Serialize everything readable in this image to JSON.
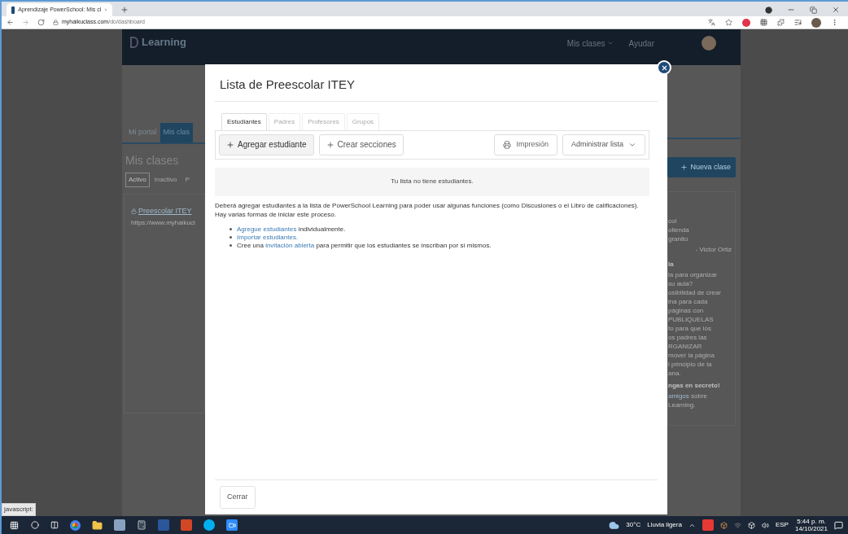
{
  "browser": {
    "tab_title": "Aprendizaje PowerSchool: Mis cl",
    "url_host": "myhaikuclass.com",
    "url_path": "/do/dashboard"
  },
  "background_page": {
    "logo": "Learning",
    "nav": [
      "Mis clases",
      "Ayudar"
    ],
    "tabs": [
      {
        "label": "Mi portal",
        "selected": false
      },
      {
        "label": "Mis clas",
        "selected": true
      }
    ],
    "heading": "Mis clases",
    "filters": [
      {
        "label": "Activo",
        "selected": true
      },
      {
        "label": "Inactivo",
        "selected": false
      },
      {
        "label": "P",
        "selected": false
      }
    ],
    "class_link": "Preescolar ITEY",
    "class_url": "https://www.myhaikucl",
    "new_class_button": "Nueva clase",
    "side_card": [
      {
        "kind": "text",
        "text": "col"
      },
      {
        "kind": "text",
        "text": "olienda"
      },
      {
        "kind": "text",
        "text": "granito"
      },
      {
        "kind": "author",
        "text": "- Victor Ortiz"
      },
      {
        "kind": "title",
        "text": "la"
      },
      {
        "kind": "text",
        "text": "la para organizar"
      },
      {
        "kind": "text",
        "text": "su aula?"
      },
      {
        "kind": "text",
        "text": "osibilidad de crear"
      },
      {
        "kind": "text",
        "text": "ina para cada"
      },
      {
        "kind": "text",
        "text": "páginas con"
      },
      {
        "kind": "text",
        "text": "PUBLIQUELAS"
      },
      {
        "kind": "text",
        "text": "to para que los"
      },
      {
        "kind": "text",
        "text": "os padres las"
      },
      {
        "kind": "text",
        "text": "RGANIZAR"
      },
      {
        "kind": "text",
        "text": "mover la página"
      },
      {
        "kind": "text",
        "text": "l principio de la"
      },
      {
        "kind": "text",
        "text": "ana."
      },
      {
        "kind": "title",
        "text": "ngas en secreto!"
      },
      {
        "kind": "link",
        "text": "amigos",
        "rest": "sobre"
      },
      {
        "kind": "text",
        "text": "Learning."
      }
    ]
  },
  "modal": {
    "title": "Lista de Preescolar ITEY",
    "tabs": [
      {
        "label": "Estudiantes",
        "selected": true
      },
      {
        "label": "Padres",
        "selected": false
      },
      {
        "label": "Profesores",
        "selected": false
      },
      {
        "label": "Grupos",
        "selected": false
      }
    ],
    "add_student_button": "Agregar estudiante",
    "sections_button": "Crear secciones",
    "print_button": "Impresión",
    "manage_button": "Administrar lista",
    "notice": "Tu lista no tiene estudiantes.",
    "paragraph": "Deberá agregar estudiantes a la lista de PowerSchool Learning para poder usar algunas funciones (como Discusiones o el Libro de calificaciones). Hay varias formas de iniciar este proceso.",
    "list": [
      [
        {
          "text": "Agregue estudiantes",
          "link": true
        },
        {
          "text": " individualmente.",
          "link": false
        }
      ],
      [
        {
          "text": "Importar estudiantes.",
          "link": true
        }
      ],
      [
        {
          "text": "Cree una ",
          "link": false
        },
        {
          "text": "invitación abierta",
          "link": true
        },
        {
          "text": " para permitir que los estudiantes se inscriban por sí mismos.",
          "link": false
        }
      ]
    ],
    "close_button": "Cerrar"
  },
  "status_text": "javascript:",
  "taskbar": {
    "temperature": "30°C",
    "weather": "Lluvia ligera",
    "language": "ESP",
    "time": "5:44 p. m.",
    "date": "14/10/2021"
  }
}
